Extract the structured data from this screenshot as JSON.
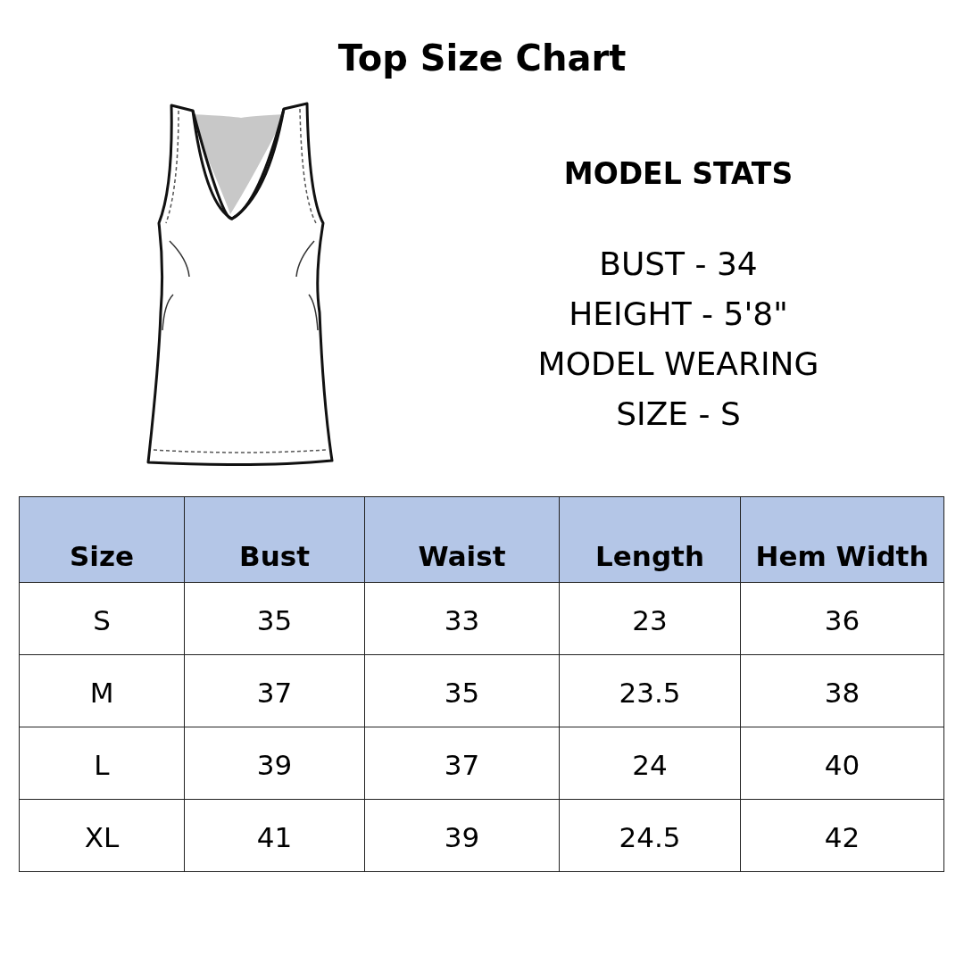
{
  "title": "Top Size Chart",
  "model_stats": {
    "heading": "MODEL STATS",
    "lines": [
      "BUST - 34",
      "HEIGHT - 5'8\"",
      "MODEL WEARING",
      "SIZE - S"
    ]
  },
  "table": {
    "columns": [
      "Size",
      "Bust",
      "Waist",
      "Length",
      "Hem Width"
    ],
    "rows": [
      [
        "S",
        "35",
        "33",
        "23",
        "36"
      ],
      [
        "M",
        "37",
        "35",
        "23.5",
        "38"
      ],
      [
        "L",
        "39",
        "37",
        "24",
        "40"
      ],
      [
        "XL",
        "41",
        "39",
        "24.5",
        "42"
      ]
    ]
  }
}
